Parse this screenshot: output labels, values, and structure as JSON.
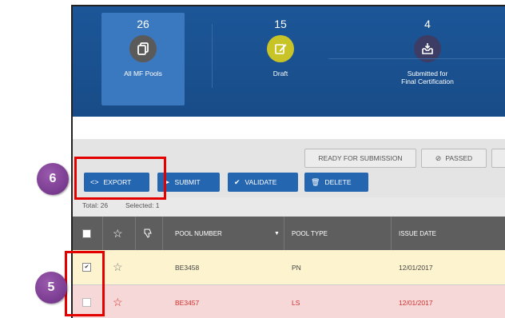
{
  "stats": [
    {
      "count": "26",
      "label": "All MF Pools",
      "icon": "copy-icon",
      "color": "#5a5a5a"
    },
    {
      "count": "15",
      "label": "Draft",
      "icon": "edit-icon",
      "color": "#c8c428"
    },
    {
      "count": "4",
      "label": "Submitted for\nFinal Certification",
      "icon": "inbox-icon",
      "color": "#3c3c64"
    }
  ],
  "filters": {
    "ready": "READY FOR SUBMISSION",
    "passed": "PASSED"
  },
  "actions": {
    "export": "EXPORT",
    "submit": "SUBMIT",
    "validate": "VALIDATE",
    "delete": "DELETE"
  },
  "status": {
    "total": "Total: 26",
    "selected": "Selected: 1"
  },
  "columns": {
    "pool_number": "POOL NUMBER",
    "pool_type": "POOL TYPE",
    "issue_date": "ISSUE DATE"
  },
  "rows": [
    {
      "pool_number": "BE3458",
      "pool_type": "PN",
      "issue_date": "12/01/2017",
      "checked": true
    },
    {
      "pool_number": "BE3457",
      "pool_type": "LS",
      "issue_date": "12/01/2017",
      "checked": false
    }
  ],
  "badges": {
    "six": "6",
    "five": "5"
  },
  "colors": {
    "header": "#1b5496",
    "button": "#2566b1",
    "highlight": "#e50000",
    "badge": "#7b3a93"
  }
}
